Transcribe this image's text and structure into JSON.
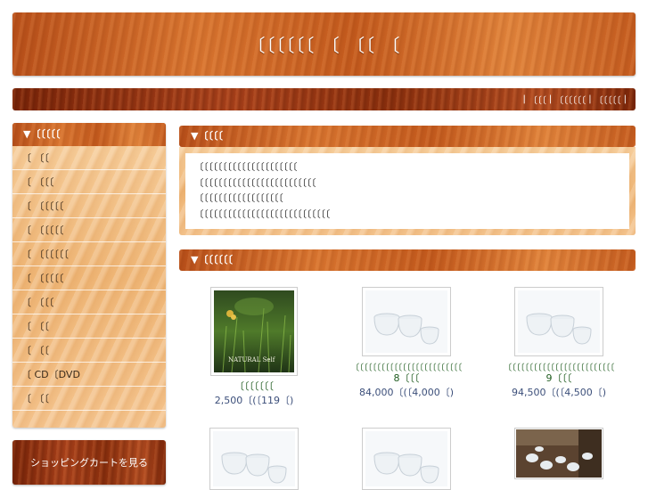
{
  "header": {
    "title": "〔〔〔〔〔〔 〔 〔〔 〔"
  },
  "topnav": {
    "links": [
      "〔〔〔",
      "〔〔〔〔〔〔",
      "〔〔〔〔〔"
    ],
    "separator": "|"
  },
  "sidebar": {
    "heading": "▼〔〔〔〔〔",
    "items": [
      "〔 〔〔",
      "〔 〔〔〔",
      "〔 〔〔〔〔〔",
      "〔 〔〔〔〔〔",
      "〔 〔〔〔〔〔〔",
      "〔 〔〔〔〔〔",
      "〔 〔〔〔",
      "〔 〔〔",
      "〔 〔〔",
      "〔 CD〔DVD",
      "〔 〔〔"
    ],
    "cart_label": "ショッピングカートを見る"
  },
  "info": {
    "heading": "▼〔〔〔〔",
    "lines": [
      "〔〔〔〔〔〔〔〔〔〔〔〔〔〔〔〔〔〔〔〔〔",
      "〔〔〔〔〔〔〔〔〔〔〔〔〔〔〔〔〔〔〔〔〔〔〔〔〔",
      "〔〔〔〔〔〔〔〔〔〔〔〔〔〔〔〔〔〔",
      "〔〔〔〔〔〔〔〔〔〔〔〔〔〔〔〔〔〔〔〔〔〔〔〔〔〔〔〔"
    ]
  },
  "products": {
    "heading": "▼〔〔〔〔〔〔",
    "album_text": "NATURAL Self",
    "items": [
      {
        "name": "〔〔〔〔〔〔〔",
        "price": "2,500〔(〔119〔)",
        "image": "cd-cover-forest"
      },
      {
        "name_line1": "〔〔〔〔〔〔〔〔〔〔〔〔〔〔〔〔〔〔〔〔〔〔〔〔〔",
        "name_line2": "8〔〔〔",
        "price": "84,000〔(〔4,000〔)",
        "image": "crystal-bowls"
      },
      {
        "name_line1": "〔〔〔〔〔〔〔〔〔〔〔〔〔〔〔〔〔〔〔〔〔〔〔〔〔",
        "name_line2": "9〔〔〔",
        "price": "94,500〔(〔4,500〔)",
        "image": "crystal-bowls"
      },
      {
        "image": "crystal-bowls"
      },
      {
        "image": "crystal-bowls"
      },
      {
        "image": "bowls-on-wood-floor"
      }
    ]
  }
}
